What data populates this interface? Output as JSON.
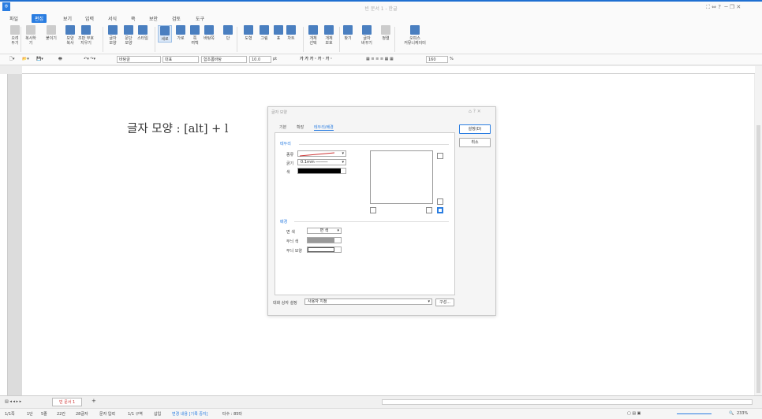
{
  "window": {
    "title": "빈 문서 1 - 한글"
  },
  "menu": {
    "file": "파일",
    "items": [
      "편집",
      "보기",
      "입력",
      "서식",
      "쪽",
      "보안",
      "검토",
      "도구"
    ]
  },
  "ribbon": {
    "buttons": [
      {
        "id": "cut",
        "label": "오려\n두기"
      },
      {
        "id": "copy",
        "label": "복사하기"
      },
      {
        "id": "paste",
        "label": "붙이기"
      },
      {
        "id": "fmtcopy",
        "label": "모양\n복사"
      },
      {
        "id": "clearfmt",
        "label": "조판 부호\n지우기"
      },
      {
        "id": "charshape",
        "label": "글자\n모양"
      },
      {
        "id": "parashape",
        "label": "문단\n모양"
      },
      {
        "id": "style",
        "label": "스타일"
      },
      {
        "id": "vertical",
        "label": "세로"
      },
      {
        "id": "horizontal",
        "label": "가로"
      },
      {
        "id": "margin",
        "label": "쪽\n여백"
      },
      {
        "id": "pagebg",
        "label": "바탕쪽"
      },
      {
        "id": "column",
        "label": "단"
      },
      {
        "id": "shape",
        "label": "도형"
      },
      {
        "id": "picture",
        "label": "그림"
      },
      {
        "id": "table",
        "label": "표"
      },
      {
        "id": "chart",
        "label": "차트"
      },
      {
        "id": "objsel",
        "label": "개체\n선택"
      },
      {
        "id": "objprot",
        "label": "개체\n보호"
      },
      {
        "id": "find",
        "label": "찾기"
      },
      {
        "id": "replace",
        "label": "글자\n바꾸기"
      },
      {
        "id": "sort",
        "label": "정렬"
      },
      {
        "id": "navigator",
        "label": "오피스\n커뮤니케이터"
      }
    ]
  },
  "format": {
    "style": "바탕글",
    "lang": "대표",
    "font": "함초롬바탕",
    "size": "10.0",
    "unit": "pt",
    "zoom": "160",
    "zoom_unit": "%"
  },
  "document": {
    "text": "글자 모양 : [alt] + l"
  },
  "dialog": {
    "title": "글자 모양",
    "tabs": [
      "기본",
      "확장",
      "테두리/배경"
    ],
    "border_section": "테두리",
    "type_label": "종류",
    "width_label": "굵기",
    "width_value": "0.1mm",
    "color_label": "색",
    "bg_section": "배경",
    "face_label": "면 색",
    "face_value": "면 색",
    "pattern_color_label": "무늬 색",
    "pattern_label": "무늬 모양",
    "preset_label": "대화 상자 설정",
    "preset_value": "사용자 지정",
    "compose_button": "구성...",
    "ok_button": "설정(D)",
    "cancel_button": "취소"
  },
  "tabbar": {
    "tab": "빈 문서 1",
    "add": "+"
  },
  "status": {
    "page": "1/1쪽",
    "section": "1단",
    "line": "5줄",
    "col": "22칸",
    "chars": "28글자",
    "mode": "문자 입력",
    "area": "1/1 구역",
    "insert": "삽입",
    "track": "변경 내용 [기록 중지]",
    "typing": "타수 : 85타",
    "zoom": "233%"
  },
  "colors": {
    "accent": "#2a7de1",
    "border_color": "#000000",
    "pattern_color": "#999999"
  }
}
